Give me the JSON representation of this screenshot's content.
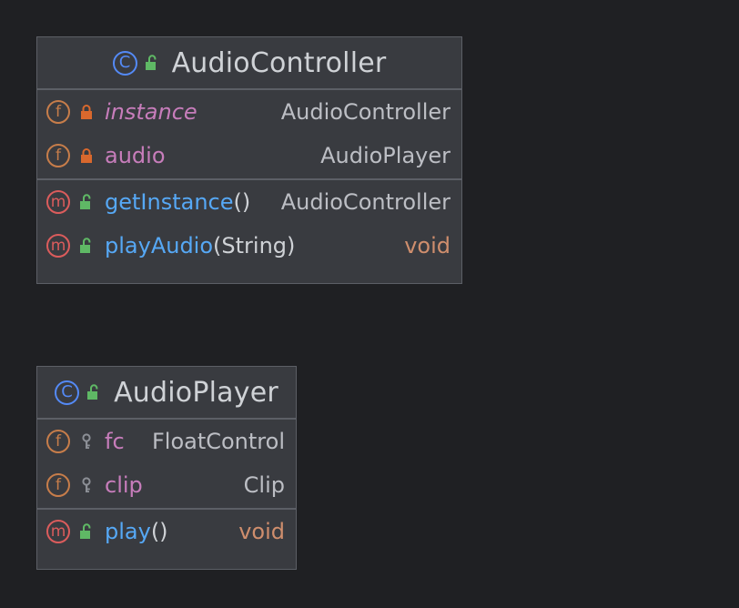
{
  "classes": [
    {
      "name": "AudioController",
      "kind_glyph": "C",
      "fields": [
        {
          "name": "instance",
          "type": "AudioController",
          "static": true,
          "visibility": "private"
        },
        {
          "name": "audio",
          "type": "AudioPlayer",
          "static": false,
          "visibility": "private"
        }
      ],
      "methods": [
        {
          "name": "getInstance",
          "params": "()",
          "type": "AudioController",
          "visibility": "public"
        },
        {
          "name": "playAudio",
          "params": "(String)",
          "type": "void",
          "visibility": "public"
        }
      ]
    },
    {
      "name": "AudioPlayer",
      "kind_glyph": "C",
      "fields": [
        {
          "name": "fc",
          "type": "FloatControl",
          "visibility": "package-private"
        },
        {
          "name": "clip",
          "type": "Clip",
          "visibility": "package-private"
        }
      ],
      "methods": [
        {
          "name": "play",
          "params": "()",
          "type": "void",
          "visibility": "public"
        }
      ]
    }
  ],
  "badges": {
    "field": "f",
    "method": "m"
  },
  "colors": {
    "background": "#1f2023",
    "box": "#393b40",
    "border": "#5c5f66",
    "class_icon": "#548af7",
    "field_icon": "#c77d4a",
    "method_icon": "#db5c5c",
    "field_name": "#c77dbb",
    "method_name": "#56a8f5",
    "void_type": "#cf8e6d",
    "public_icon": "#5fb865",
    "private_icon": "#d9682d",
    "package_icon": "#8c8f96"
  },
  "icons": {
    "class": "class-c-icon",
    "public": "unlocked-padlock-icon",
    "private": "locked-padlock-icon",
    "package-private": "key-icon"
  }
}
